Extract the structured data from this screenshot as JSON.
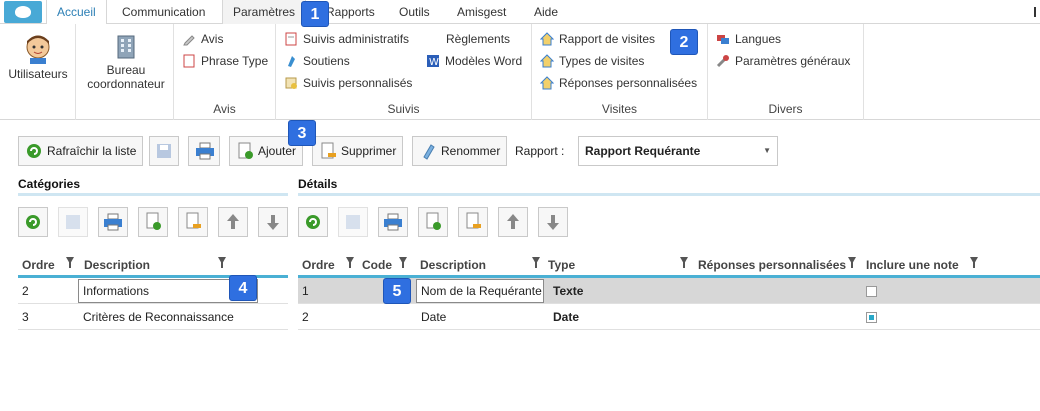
{
  "tabs": [
    "Accueil",
    "Communication",
    "Paramètres",
    "Rapports",
    "Outils",
    "Amisgest",
    "Aide"
  ],
  "ribbon": {
    "utilisateurs": "Utilisateurs",
    "bureau_line1": "Bureau",
    "bureau_line2": "coordonnateur",
    "avis_items": [
      "Avis",
      "Phrase Type"
    ],
    "avis_label": "Avis",
    "suivis_items": [
      "Suivis administratifs",
      "Soutiens",
      "Suivis personnalisés"
    ],
    "suivis_items2": [
      "Règlements",
      "Modèles Word"
    ],
    "suivis_label": "Suivis",
    "visites_items": [
      "Rapport de visites",
      "Types de visites",
      "Réponses personnalisées"
    ],
    "visites_label": "Visites",
    "divers_items": [
      "Langues",
      "Paramètres généraux"
    ],
    "divers_label": "Divers"
  },
  "toolbar": {
    "refresh": "Rafraîchir la liste",
    "add": "Ajouter",
    "delete": "Supprimer",
    "rename": "Renommer",
    "rapport_label": "Rapport :",
    "rapport_value": "Rapport Requérante"
  },
  "categories": {
    "title": "Catégories",
    "columns": [
      "Ordre",
      "Description"
    ],
    "rows": [
      {
        "ordre": "2",
        "description": "Informations"
      },
      {
        "ordre": "3",
        "description": "Critères de Reconnaissance"
      }
    ]
  },
  "details": {
    "title": "Détails",
    "columns": [
      "Ordre",
      "Code",
      "Description",
      "Type",
      "Réponses personnalisées",
      "Inclure une note"
    ],
    "rows": [
      {
        "ordre": "1",
        "code": "",
        "description": "Nom de la Requérante",
        "type": "Texte",
        "reponses": "",
        "note": false
      },
      {
        "ordre": "2",
        "code": "",
        "description": "Date",
        "type": "Date",
        "reponses": "",
        "note": true
      }
    ]
  },
  "callouts": [
    "1",
    "2",
    "3",
    "4",
    "5"
  ],
  "colors": {
    "accent": "#2c7fb5",
    "callout": "#2f6fe0",
    "header_rule": "#4ab0d4"
  }
}
